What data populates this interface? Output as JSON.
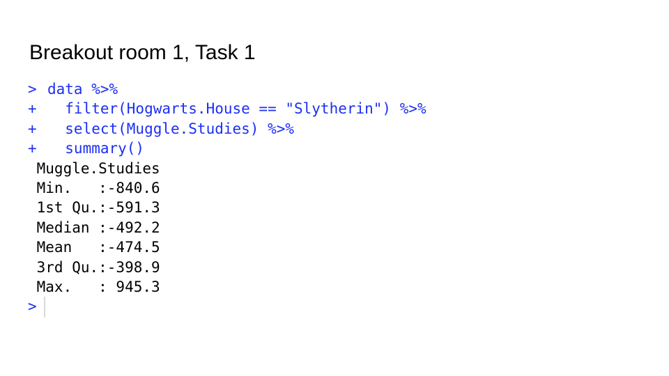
{
  "slide": {
    "title": "Breakout room 1, Task 1"
  },
  "console": {
    "input_lines": [
      {
        "prompt": ">",
        "code": "data %>%"
      },
      {
        "prompt": "+",
        "code": "  filter(Hogwarts.House == \"Slytherin\") %>%"
      },
      {
        "prompt": "+",
        "code": "  select(Muggle.Studies) %>%"
      },
      {
        "prompt": "+",
        "code": "  summary()"
      }
    ],
    "output_lines": [
      " Muggle.Studies",
      " Min.   :-840.6",
      " 1st Qu.:-591.3",
      " Median :-492.2",
      " Mean   :-474.5",
      " 3rd Qu.:-398.9",
      " Max.   : 945.3"
    ],
    "current_prompt": ">"
  },
  "colors": {
    "command_text": "#1d2ff2",
    "output_text": "#000000",
    "cursor": "#d8d8d8"
  }
}
